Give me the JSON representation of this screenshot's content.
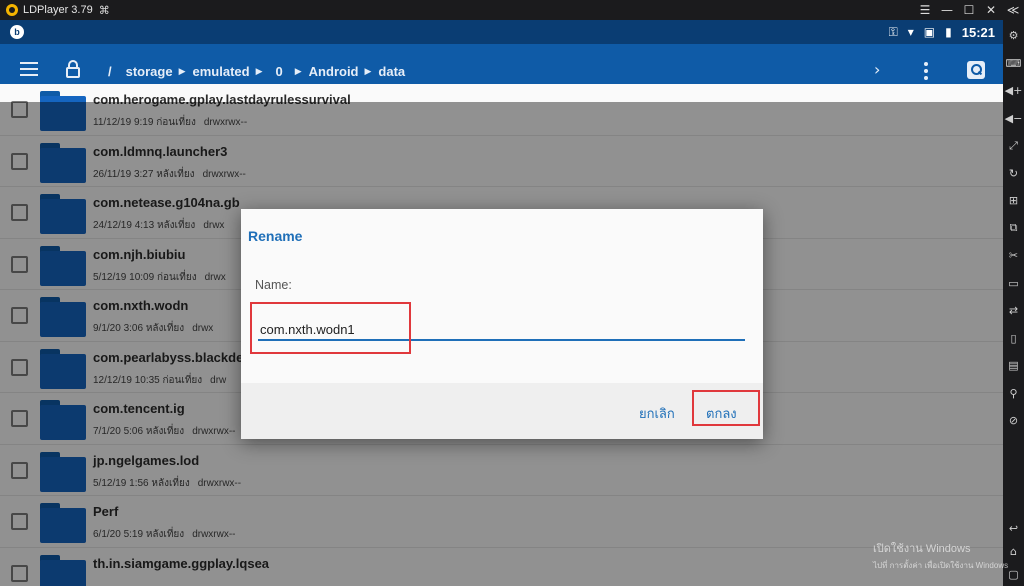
{
  "emulator": {
    "title": "LDPlayer 3.79",
    "icons": [
      "ldplayer-logo",
      "gamepad-icon",
      "hamburger-menu-icon",
      "minimize-icon",
      "maximize-icon",
      "close-icon",
      "collapse-sidebar-icon"
    ],
    "window_controls": [
      "☰",
      "—",
      "☐",
      "✕",
      "≪"
    ],
    "sidebar_tools": [
      {
        "name": "settings-icon",
        "glyph": "⚙"
      },
      {
        "name": "keyboard-icon",
        "glyph": "⌨"
      },
      {
        "name": "volume-up-icon",
        "glyph": "◀+"
      },
      {
        "name": "volume-down-icon",
        "glyph": "◀−"
      },
      {
        "name": "fullscreen-icon",
        "glyph": "⤢"
      },
      {
        "name": "rotate-icon",
        "glyph": "↻"
      },
      {
        "name": "add-apk-icon",
        "glyph": "⊞"
      },
      {
        "name": "screenshot-icon",
        "glyph": "⧉"
      },
      {
        "name": "scissors-icon",
        "glyph": "✂"
      },
      {
        "name": "record-icon",
        "glyph": "▭"
      },
      {
        "name": "sync-icon",
        "glyph": "⇄"
      },
      {
        "name": "shake-icon",
        "glyph": "▯"
      },
      {
        "name": "display-icon",
        "glyph": "▤"
      },
      {
        "name": "location-icon",
        "glyph": "⚲"
      },
      {
        "name": "operation-record-icon",
        "glyph": "⊘"
      }
    ],
    "bottom_tools": [
      {
        "name": "back-icon",
        "glyph": "↩"
      },
      {
        "name": "home-icon",
        "glyph": "⌂"
      },
      {
        "name": "recent-apps-icon",
        "glyph": "▢"
      }
    ]
  },
  "statusbar": {
    "time": "15:21",
    "app_icon": "b",
    "icons": [
      "key-icon",
      "wifi-icon",
      "no-sim-icon",
      "battery-icon"
    ],
    "glyphs": [
      "⚿",
      "▾",
      "▣",
      "▮"
    ]
  },
  "appbar": {
    "breadcrumb": [
      "/",
      "storage",
      "emulated",
      "0",
      "Android",
      "data"
    ],
    "icons": [
      "menu-icon",
      "lock-icon",
      "next-icon",
      "more-vert-icon",
      "search-icon"
    ],
    "next_glyph": "›",
    "progress_fraction": 0.66
  },
  "files": [
    {
      "name": "com.herogame.gplay.lastdayrulessurvival",
      "date": "11/12/19 9:19 ก่อนเที่ยง",
      "perm": "drwxrwx--"
    },
    {
      "name": "com.ldmnq.launcher3",
      "date": "26/11/19 3:27 หลังเที่ยง",
      "perm": "drwxrwx--"
    },
    {
      "name": "com.netease.g104na.gb",
      "date": "24/12/19 4:13 หลังเที่ยง",
      "perm": "drwx"
    },
    {
      "name": "com.njh.biubiu",
      "date": "5/12/19 10:09 ก่อนเที่ยง",
      "perm": "drwx"
    },
    {
      "name": "com.nxth.wodn",
      "date": "9/1/20 3:06 หลังเที่ยง",
      "perm": "drwx"
    },
    {
      "name": "com.pearlabyss.blackdes",
      "date": "12/12/19 10:35 ก่อนเที่ยง",
      "perm": "drw"
    },
    {
      "name": "com.tencent.ig",
      "date": "7/1/20 5:06 หลังเที่ยง",
      "perm": "drwxrwx--"
    },
    {
      "name": "jp.ngelgames.lod",
      "date": "5/12/19 1:56 หลังเที่ยง",
      "perm": "drwxrwx--"
    },
    {
      "name": "Perf",
      "date": "6/1/20 5:19 หลังเที่ยง",
      "perm": "drwxrwx--"
    },
    {
      "name": "th.in.siamgame.ggplay.lqsea",
      "date": "",
      "perm": ""
    }
  ],
  "dialog": {
    "title": "Rename",
    "field_label": "Name:",
    "input_value": "com.nxth.wodn1",
    "cancel_label": "ยกเลิก",
    "ok_label": "ตกลง",
    "highlight_color": "#e0383c",
    "accent_color": "#1f6fb8"
  },
  "watermark": {
    "line1": "เปิดใช้งาน Windows",
    "line2": "ไปที่ การตั้งค่า เพื่อเปิดใช้งาน Windows"
  },
  "colors": {
    "statusbar": "#0a3d73",
    "appbar": "#0f5ba7",
    "folder": "#1565c0"
  }
}
